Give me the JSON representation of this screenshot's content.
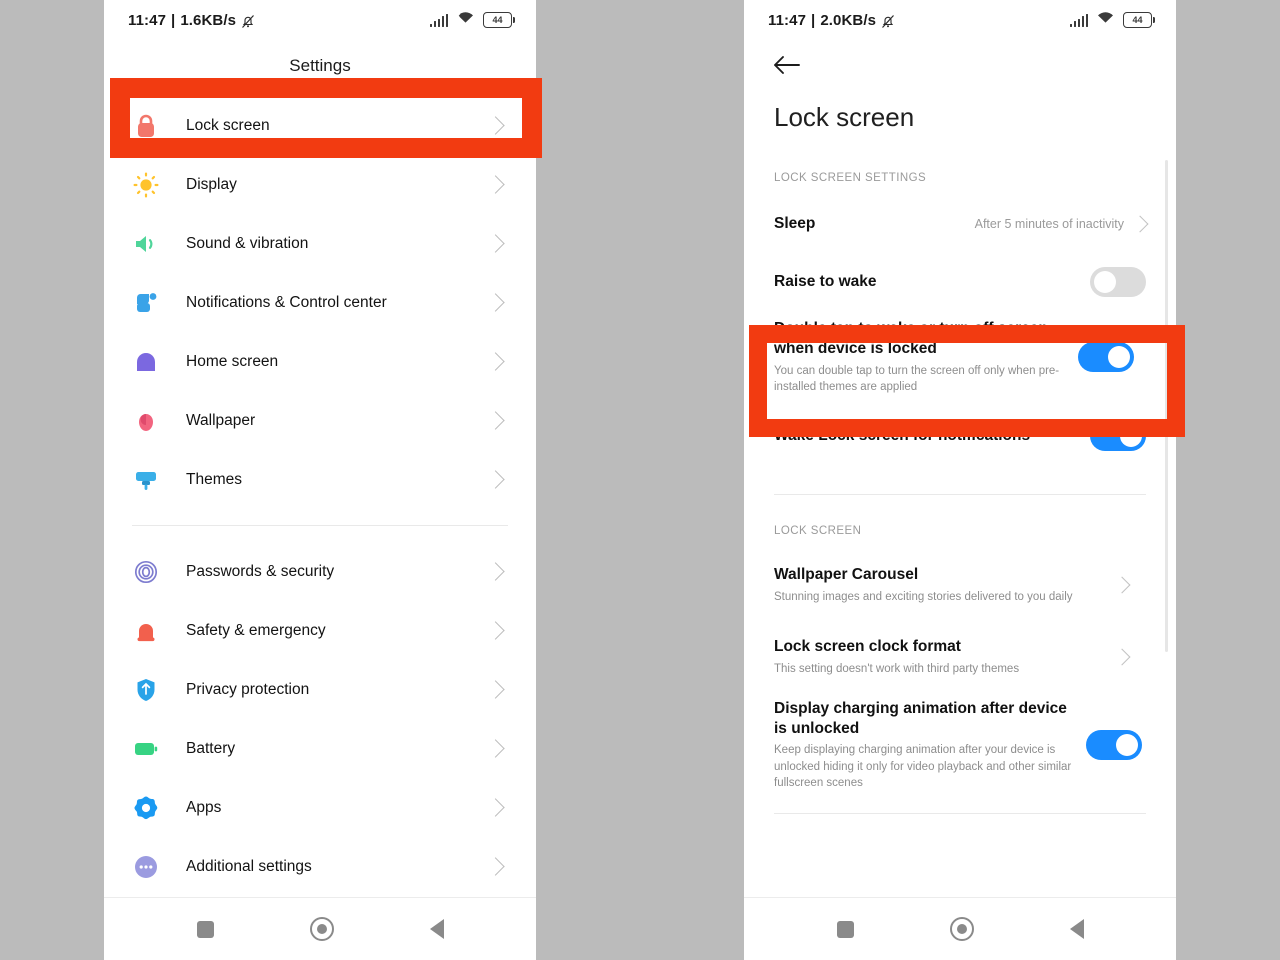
{
  "statusbar_left": {
    "time": "11:47",
    "sep": "|",
    "speed": "1.6KB/s",
    "mute_icon": "bell-mute-icon",
    "signal_icon": "signal-bars-icon",
    "wifi_icon": "wifi-icon",
    "battery": "44"
  },
  "statusbar_right": {
    "time": "11:47",
    "sep": "|",
    "speed": "2.0KB/s",
    "mute_icon": "bell-mute-icon",
    "signal_icon": "signal-bars-icon",
    "wifi_icon": "wifi-icon",
    "battery": "44"
  },
  "settings_screen": {
    "title": "Settings",
    "items": [
      {
        "label": "Lock screen",
        "icon": "lock-icon",
        "color": "#f2776b"
      },
      {
        "label": "Display",
        "icon": "brightness-icon",
        "color": "#ffc32b"
      },
      {
        "label": "Sound & vibration",
        "icon": "speaker-icon",
        "color": "#4fd59a"
      },
      {
        "label": "Notifications & Control center",
        "icon": "notification-icon",
        "color": "#3aa3e8"
      },
      {
        "label": "Home screen",
        "icon": "home-icon",
        "color": "#7b68e0"
      },
      {
        "label": "Wallpaper",
        "icon": "flower-icon",
        "color": "#f2647f"
      },
      {
        "label": "Themes",
        "icon": "paintbrush-icon",
        "color": "#3aafe8"
      }
    ],
    "items2": [
      {
        "label": "Passwords & security",
        "icon": "fingerprint-icon",
        "color": "#7d7ccf"
      },
      {
        "label": "Safety & emergency",
        "icon": "emergency-bell-icon",
        "color": "#f2604d"
      },
      {
        "label": "Privacy protection",
        "icon": "shield-icon",
        "color": "#29a3e8"
      },
      {
        "label": "Battery",
        "icon": "battery-icon",
        "color": "#37d383"
      },
      {
        "label": "Apps",
        "icon": "gear-icon",
        "color": "#1a9af2"
      },
      {
        "label": "Additional settings",
        "icon": "ellipsis-icon",
        "color": "#9b9be0"
      }
    ],
    "chevron_icon": "chevron-right-icon"
  },
  "lockscreen_screen": {
    "back_icon": "arrow-left-icon",
    "title": "Lock screen",
    "section_1_header": "LOCK SCREEN SETTINGS",
    "section_2_header": "LOCK SCREEN",
    "sleep": {
      "title": "Sleep",
      "value": "After 5 minutes of inactivity",
      "chevron_icon": "chevron-right-icon"
    },
    "raise_to_wake": {
      "title": "Raise to wake",
      "toggle_state": "off"
    },
    "double_tap": {
      "title": "Double tap to wake or turn off screen when device is locked",
      "subtitle": "You can double tap to turn the screen off only when pre-installed themes are applied",
      "toggle_state": "on"
    },
    "wake_lock": {
      "title": "Wake Lock screen for notifications",
      "toggle_state": "on"
    },
    "wallpaper_carousel": {
      "title": "Wallpaper Carousel",
      "subtitle": "Stunning images and exciting stories delivered to you daily",
      "chevron_icon": "chevron-right-icon"
    },
    "clock_format": {
      "title": "Lock screen clock format",
      "subtitle": "This setting doesn't work with third party themes",
      "chevron_icon": "chevron-right-icon"
    },
    "charging_animation": {
      "title": "Display charging animation after device is unlocked",
      "subtitle": "Keep displaying charging animation after your device is unlocked hiding it only for video playback and other similar fullscreen scenes",
      "toggle_state": "on"
    },
    "scrollbar": "vertical-scrollbar"
  },
  "navbar": {
    "recents_icon": "square-recents-icon",
    "home_icon": "circle-home-icon",
    "back_icon": "triangle-back-icon"
  },
  "annotations": {
    "highlight_color": "#f23b11",
    "box_1_target": "Lock screen",
    "box_2_target": "Double tap to wake or turn off screen when device is locked"
  }
}
